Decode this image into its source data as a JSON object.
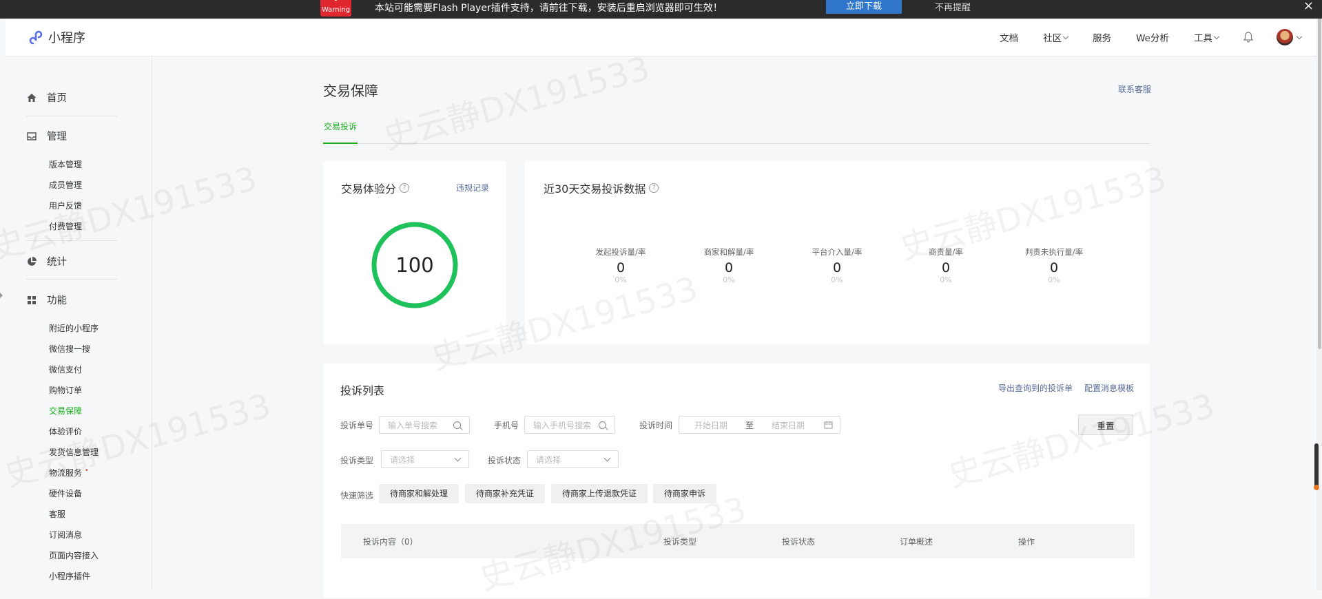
{
  "flashbar": {
    "warning_label": "Warning",
    "message": "本站可能需要Flash Player插件支持，请前往下载，安装后重启浏览器即可生效！",
    "download_button": "立即下载",
    "dismiss_label": "不再提醒",
    "close": "×"
  },
  "topnav": {
    "brand": "小程序",
    "docs": "文档",
    "community": "社区",
    "services": "服务",
    "we_analytics": "We分析",
    "tools": "工具"
  },
  "sidebar": {
    "home": "首页",
    "manage": "管理",
    "manage_items": [
      "版本管理",
      "成员管理",
      "用户反馈",
      "付费管理"
    ],
    "stats": "统计",
    "features": "功能",
    "feature_items": [
      "附近的小程序",
      "微信搜一搜",
      "微信支付",
      "购物订单",
      "交易保障",
      "体验评价",
      "发货信息管理",
      "物流服务",
      "硬件设备",
      "客服",
      "订阅消息",
      "页面内容接入",
      "小程序插件"
    ],
    "new_dot": "•"
  },
  "main": {
    "title": "交易保障",
    "contact_link": "联系客服",
    "tab": "交易投诉",
    "score_card": {
      "title": "交易体验分",
      "help": "?",
      "violation_link": "违规记录",
      "score": "100"
    },
    "stats_card": {
      "title": "近30天交易投诉数据",
      "help": "?",
      "metrics": [
        {
          "label": "发起投诉量/率",
          "value": "0",
          "pct": "0%"
        },
        {
          "label": "商家和解量/率",
          "value": "0",
          "pct": "0%"
        },
        {
          "label": "平台介入量/率",
          "value": "0",
          "pct": "0%"
        },
        {
          "label": "商责量/率",
          "value": "0",
          "pct": "0%"
        },
        {
          "label": "判责未执行量/率",
          "value": "0",
          "pct": "0%"
        }
      ]
    },
    "complaints": {
      "title": "投诉列表",
      "export_link": "导出查询到的投诉单",
      "template_link": "配置消息模板",
      "order_no_label": "投诉单号",
      "order_no_placeholder": "输入单号搜索",
      "phone_label": "手机号",
      "phone_placeholder": "输入手机号搜索",
      "time_label": "投诉时间",
      "start_date": "开始日期",
      "to": "至",
      "end_date": "结束日期",
      "reset_button": "重置",
      "type_label": "投诉类型",
      "type_placeholder": "请选择",
      "status_label": "投诉状态",
      "status_placeholder": "请选择",
      "quick_label": "快速筛选",
      "quick_filters": [
        "待商家和解处理",
        "待商家补充凭证",
        "待商家上传退款凭证",
        "待商家申诉"
      ],
      "columns": [
        "投诉内容（0）",
        "投诉类型",
        "投诉状态",
        "订单概述",
        "操作"
      ]
    }
  },
  "watermark": "史云静DX191533",
  "colors": {
    "accent": "#1aad19",
    "link": "#576b95",
    "score_ring": "#1ec15a"
  }
}
